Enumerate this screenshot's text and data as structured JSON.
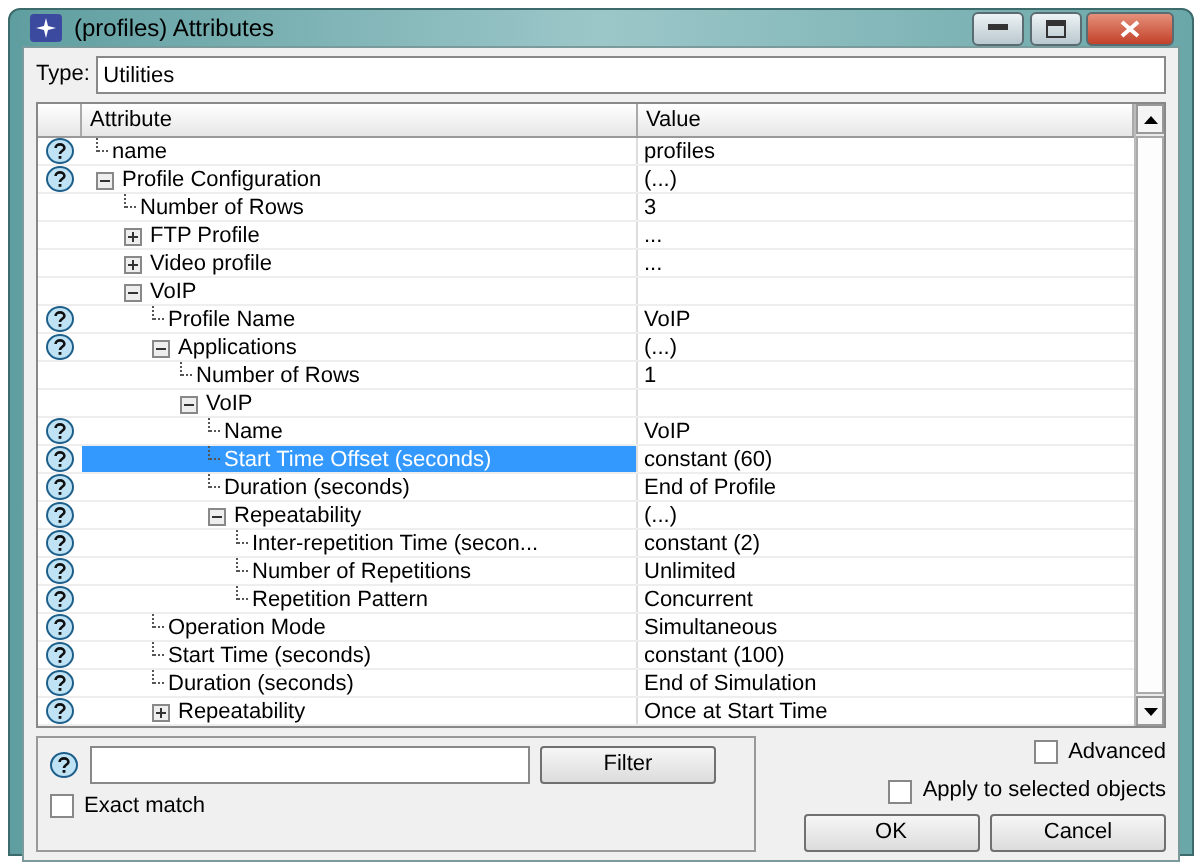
{
  "window": {
    "title": "(profiles) Attributes"
  },
  "type_field": {
    "label": "Type:",
    "value": "Utilities"
  },
  "table": {
    "columns": [
      "Attribute",
      "Value"
    ],
    "rows": [
      {
        "attribute": "name",
        "value": "profiles",
        "help": true,
        "selected": false
      },
      {
        "attribute": "Profile Configuration",
        "value": "(...)",
        "help": true,
        "selected": false,
        "expanded": true,
        "children": [
          {
            "attribute": "Number of Rows",
            "value": "3",
            "help": false,
            "selected": false
          },
          {
            "attribute": "FTP Profile",
            "value": "...",
            "help": false,
            "selected": false,
            "expanded": false
          },
          {
            "attribute": "Video profile",
            "value": "...",
            "help": false,
            "selected": false,
            "expanded": false
          },
          {
            "attribute": "VoIP",
            "help": false,
            "selected": false,
            "expanded": true,
            "children": [
              {
                "attribute": "Profile Name",
                "value": "VoIP",
                "help": true,
                "selected": false
              },
              {
                "attribute": "Applications",
                "value": "(...)",
                "help": true,
                "selected": false,
                "expanded": true,
                "children": [
                  {
                    "attribute": "Number of Rows",
                    "value": "1",
                    "help": false,
                    "selected": false
                  },
                  {
                    "attribute": "VoIP",
                    "help": false,
                    "selected": false,
                    "expanded": true,
                    "children": [
                      {
                        "attribute": "Name",
                        "value": "VoIP",
                        "help": true,
                        "selected": false
                      },
                      {
                        "attribute": "Start Time Offset (seconds)",
                        "value": "constant (60)",
                        "help": true,
                        "selected": true
                      },
                      {
                        "attribute": "Duration (seconds)",
                        "value": "End of Profile",
                        "help": true,
                        "selected": false
                      },
                      {
                        "attribute": "Repeatability",
                        "value": "(...)",
                        "help": true,
                        "selected": false,
                        "expanded": true,
                        "children": [
                          {
                            "attribute": "Inter-repetition Time (secon...",
                            "value": "constant (2)",
                            "help": true,
                            "selected": false
                          },
                          {
                            "attribute": "Number of Repetitions",
                            "value": "Unlimited",
                            "help": true,
                            "selected": false
                          },
                          {
                            "attribute": "Repetition Pattern",
                            "value": "Concurrent",
                            "help": true,
                            "selected": false
                          }
                        ]
                      }
                    ]
                  }
                ]
              },
              {
                "attribute": "Operation Mode",
                "value": "Simultaneous",
                "help": true,
                "selected": false
              },
              {
                "attribute": "Start Time (seconds)",
                "value": "constant (100)",
                "help": true,
                "selected": false
              },
              {
                "attribute": "Duration (seconds)",
                "value": "End of Simulation",
                "help": true,
                "selected": false
              },
              {
                "attribute": "Repeatability",
                "value": "Once at Start Time",
                "help": true,
                "selected": false,
                "expanded": false
              }
            ]
          }
        ]
      }
    ]
  },
  "filter": {
    "button": "Filter",
    "exact_match": {
      "label": "Exact match",
      "checked": false
    }
  },
  "advanced": {
    "label": "Advanced",
    "checked": false
  },
  "apply_to_selected": {
    "label": "Apply to selected objects",
    "checked": false
  },
  "buttons": [
    "OK",
    "Cancel"
  ]
}
